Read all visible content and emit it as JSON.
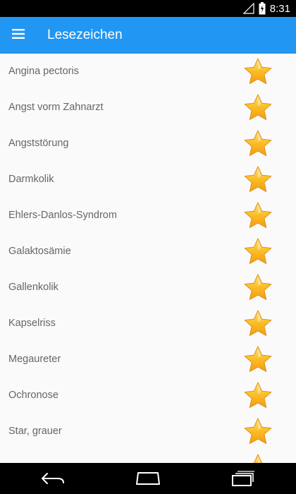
{
  "status_bar": {
    "time": "8:31",
    "icons": [
      "signal-icon",
      "battery-icon"
    ]
  },
  "app_bar": {
    "menu_icon": "hamburger-menu-icon",
    "title": "Lesezeichen"
  },
  "bookmarks": {
    "star_icon": "star-icon",
    "star_color": "#f9b81b",
    "items": [
      {
        "label": "Angina pectoris"
      },
      {
        "label": "Angst vorm Zahnarzt"
      },
      {
        "label": "Angststörung"
      },
      {
        "label": "Darmkolik"
      },
      {
        "label": "Ehlers-Danlos-Syndrom"
      },
      {
        "label": "Galaktosämie"
      },
      {
        "label": "Gallenkolik"
      },
      {
        "label": "Kapselriss"
      },
      {
        "label": "Megaureter"
      },
      {
        "label": "Ochronose"
      },
      {
        "label": "Star, grauer"
      }
    ]
  },
  "nav_bar": {
    "icons": [
      "back-icon",
      "home-icon",
      "recents-icon"
    ]
  },
  "colors": {
    "app_bar": "#2196f3",
    "list_background": "#fafafa",
    "item_text": "#666666"
  }
}
